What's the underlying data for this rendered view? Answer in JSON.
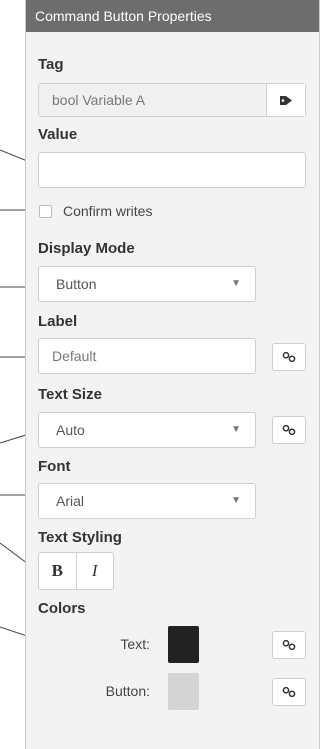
{
  "panel": {
    "title": "Command Button Properties"
  },
  "tag": {
    "label": "Tag",
    "value": "bool Variable A",
    "icon": "tag-icon"
  },
  "value": {
    "label": "Value",
    "value": ""
  },
  "confirm": {
    "label": "Confirm writes",
    "checked": false
  },
  "display_mode": {
    "label": "Display Mode",
    "selected": "Button"
  },
  "label_field": {
    "label": "Label",
    "value": "Default"
  },
  "text_size": {
    "label": "Text Size",
    "selected": "Auto"
  },
  "font": {
    "label": "Font",
    "selected": "Arial"
  },
  "text_styling": {
    "label": "Text Styling",
    "bold": "B",
    "italic": "I"
  },
  "colors": {
    "label": "Colors",
    "text_label": "Text:",
    "text_color": "#222222",
    "button_label": "Button:",
    "button_color": "#d4d4d4"
  },
  "arrow_glyph": "▼"
}
